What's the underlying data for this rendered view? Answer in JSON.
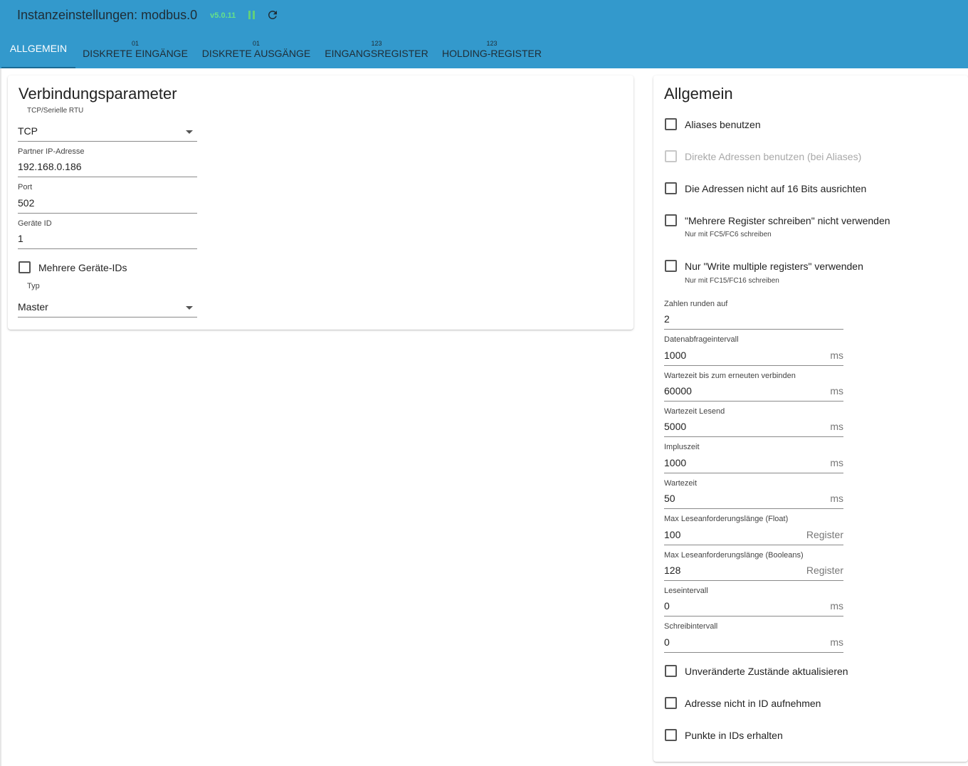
{
  "header": {
    "title": "Instanzeinstellungen: modbus.0",
    "version": "v5.0.11",
    "pause_icon": "pause-icon",
    "reload_icon": "reload-icon",
    "colors": {
      "bar": "#3399cc",
      "version": "#66e08a"
    }
  },
  "tabs": [
    {
      "label": "ALLGEMEIN",
      "sup": "",
      "active": true
    },
    {
      "label": "DISKRETE EINGÄNGE",
      "sup": "01"
    },
    {
      "label": "DISKRETE AUSGÄNGE",
      "sup": "01"
    },
    {
      "label": "EINGANGSREGISTER",
      "sup": "123"
    },
    {
      "label": "HOLDING-REGISTER",
      "sup": "123"
    }
  ],
  "connection": {
    "title": "Verbindungsparameter",
    "mode_label": "TCP/Serielle RTU",
    "mode_value": "TCP",
    "ip_label": "Partner IP-Adresse",
    "ip_value": "192.168.0.186",
    "port_label": "Port",
    "port_value": "502",
    "device_id_label": "Geräte ID",
    "device_id_value": "1",
    "multi_ids_label": "Mehrere Geräte-IDs",
    "multi_ids_checked": false,
    "type_label": "Typ",
    "type_value": "Master"
  },
  "general": {
    "title": "Allgemein",
    "aliases_label": "Aliases benutzen",
    "direct_label": "Direkte Adressen benutzen (bei Aliases)",
    "align_label": "Die Adressen nicht auf 16 Bits ausrichten",
    "multi_write_label": "\"Mehrere Register schreiben\" nicht verwenden",
    "multi_write_hint": "Nur mit FC5/FC6 schreiben",
    "only_multi_label": "Nur \"Write multiple registers\" verwenden",
    "only_multi_hint": "Nur mit FC15/FC16 schreiben",
    "round_label": "Zahlen runden auf",
    "round_value": "2",
    "poll_label": "Datenabfrageintervall",
    "poll_value": "1000",
    "reconnect_label": "Wartezeit bis zum erneuten verbinden",
    "reconnect_value": "60000",
    "read_timeout_label": "Wartezeit Lesend",
    "read_timeout_value": "5000",
    "pulse_label": "Impluszeit",
    "pulse_value": "1000",
    "wait_label": "Wartezeit",
    "wait_value": "50",
    "max_float_label": "Max Leseanforderungslänge (Float)",
    "max_float_value": "100",
    "max_bool_label": "Max Leseanforderungslänge (Booleans)",
    "max_bool_value": "128",
    "read_interval_label": "Leseintervall",
    "read_interval_value": "0",
    "write_interval_label": "Schreibintervall",
    "write_interval_value": "0",
    "unit_ms": "ms",
    "unit_register": "Register",
    "update_unchanged_label": "Unveränderte Zustände aktualisieren",
    "no_address_label": "Adresse nicht in ID aufnehmen",
    "keep_dots_label": "Punkte in IDs erhalten"
  }
}
